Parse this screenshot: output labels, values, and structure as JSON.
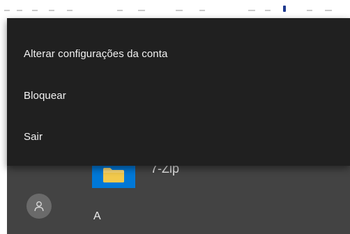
{
  "account_menu": {
    "items": [
      {
        "label": "Alterar configurações da conta"
      },
      {
        "label": "Bloquear"
      },
      {
        "label": "Sair"
      }
    ]
  },
  "app_list": {
    "partial_app": {
      "name": "7-Zip",
      "icon": "folder-icon"
    },
    "section_header": "A"
  },
  "user": {
    "icon": "user-icon"
  },
  "colors": {
    "menu_bg": "#202020",
    "panel_bg": "#434343",
    "tile_accent": "#0078d7",
    "folder_yellow": "#f8d775"
  }
}
